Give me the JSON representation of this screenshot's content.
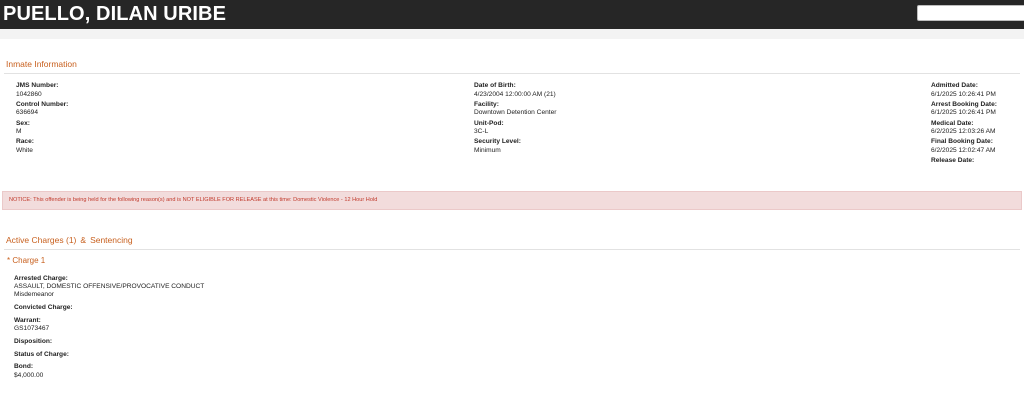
{
  "header": {
    "name": "PUELLO, DILAN URIBE",
    "search_value": ""
  },
  "inmate_info": {
    "title": "Inmate Information",
    "left": [
      {
        "label": "JMS Number:",
        "value": "1042860"
      },
      {
        "label": "Control Number:",
        "value": "636694"
      },
      {
        "label": "Sex:",
        "value": "M"
      },
      {
        "label": "Race:",
        "value": "White"
      }
    ],
    "middle": [
      {
        "label": "Date of Birth:",
        "value": "4/23/2004 12:00:00 AM (21)"
      },
      {
        "label": "Facility:",
        "value": "Downtown Detention Center"
      },
      {
        "label": "Unit-Pod:",
        "value": "3C-L"
      },
      {
        "label": "Security Level:",
        "value": "Minimum"
      }
    ],
    "right": [
      {
        "label": "Admitted Date:",
        "value": "6/1/2025 10:26:41 PM"
      },
      {
        "label": "Arrest Booking Date:",
        "value": "6/1/2025 10:26:41 PM"
      },
      {
        "label": "Medical Date:",
        "value": "6/2/2025 12:03:26 AM"
      },
      {
        "label": "Final Booking Date:",
        "value": "6/2/2025 12:02:47 AM"
      },
      {
        "label": "Release Date:",
        "value": ""
      }
    ]
  },
  "notice": {
    "text": "NOTICE: This offender is being held for the following reason(s) and is NOT ELIGIBLE FOR RELEASE at this time: Domestic Violence - 12 Hour Hold"
  },
  "charges": {
    "title_left": "Active Charges (1)",
    "separator": "&",
    "title_right": "Sentencing",
    "charge_heading": "* Charge 1",
    "arrested_charge_label": "Arrested Charge:",
    "arrested_charge_value": "ASSAULT, DOMESTIC OFFENSIVE/PROVOCATIVE CONDUCT",
    "arrested_charge_class": "Misdemeanor",
    "convicted_charge_label": "Convicted Charge:",
    "warrant_label": "Warrant:",
    "warrant_value": "GS1073467",
    "disposition_label": "Disposition:",
    "status_label": "Status of Charge:",
    "bond_label": "Bond:",
    "bond_value": "$4,000.00"
  },
  "colors": {
    "accent": "#c8601e",
    "header_bg": "#262626",
    "notice_bg": "#f2dcdc",
    "notice_text": "#c0392b"
  }
}
